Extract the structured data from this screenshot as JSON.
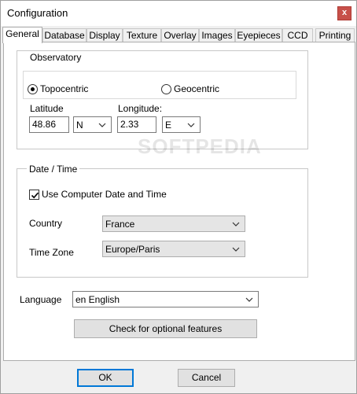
{
  "window": {
    "title": "Configuration",
    "close_glyph": "x"
  },
  "tabs": [
    {
      "label": "General",
      "active": true
    },
    {
      "label": "Database"
    },
    {
      "label": "Display"
    },
    {
      "label": "Texture"
    },
    {
      "label": "Overlay"
    },
    {
      "label": "Images"
    },
    {
      "label": "Eyepieces"
    },
    {
      "label": "CCD"
    },
    {
      "label": "Printing"
    }
  ],
  "observatory": {
    "group_label": "Observatory",
    "topocentric_label": "Topocentric",
    "topocentric_selected": true,
    "geocentric_label": "Geocentric",
    "latitude_label": "Latitude",
    "latitude_value": "48.86",
    "latitude_hemisphere": "N",
    "longitude_label": "Longitude:",
    "longitude_value": "2.33",
    "longitude_hemisphere": "E"
  },
  "datetime": {
    "group_label": "Date / Time",
    "use_computer_label": "Use Computer Date and Time",
    "use_computer_checked": true,
    "country_label": "Country",
    "country_value": "France",
    "timezone_label": "Time Zone",
    "timezone_value": "Europe/Paris"
  },
  "language": {
    "label": "Language",
    "value": "en English"
  },
  "optional_features_button": "Check for optional features",
  "footer": {
    "ok_label": "OK",
    "cancel_label": "Cancel"
  },
  "watermark": "SOFTPEDIA",
  "colors": {
    "accent": "#0078d7",
    "close_button": "#c7504a"
  }
}
